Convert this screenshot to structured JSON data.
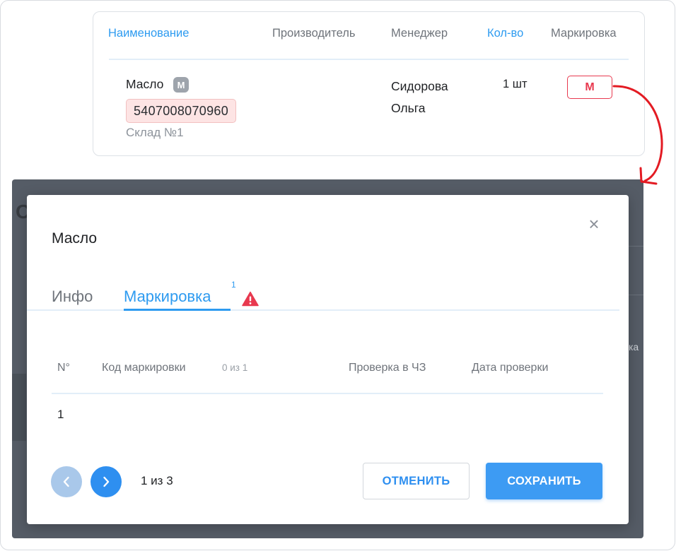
{
  "table_header": {
    "name": "Наименование",
    "manufacturer": "Производитель",
    "manager": "Менеджер",
    "quantity": "Кол-во",
    "marking": "Маркировка"
  },
  "row": {
    "name": "Масло",
    "badge": "M",
    "barcode": "5407008070960",
    "warehouse": "Склад №1",
    "manager": "Сидорова Ольга",
    "quantity": "1 шт",
    "marking_button": "М"
  },
  "modal": {
    "title": "Масло",
    "close_glyph": "×",
    "tabs": [
      {
        "label": "Инфо",
        "active": false
      },
      {
        "label": "Маркировка",
        "active": true,
        "superscript": "1",
        "warning": true
      }
    ],
    "columns": {
      "num": "N°",
      "code": "Код маркировки",
      "code_count": "0 из 1",
      "check": "Проверка в ЧЗ",
      "date": "Дата проверки"
    },
    "rows": [
      {
        "num": "1"
      }
    ],
    "pagination": {
      "text": "1 из 3"
    },
    "cancel_label": "ОТМЕНИТЬ",
    "save_label": "СОХРАНИТЬ"
  },
  "background": {
    "fragment_right": "ка",
    "fragment_left": "О"
  },
  "colors": {
    "accent": "#2e9bf0",
    "danger": "#e8394f",
    "overlay": "#555c66"
  },
  "icons": [
    "close-icon",
    "warning-icon",
    "chevron-left-icon",
    "chevron-right-icon",
    "curved-arrow-icon"
  ]
}
